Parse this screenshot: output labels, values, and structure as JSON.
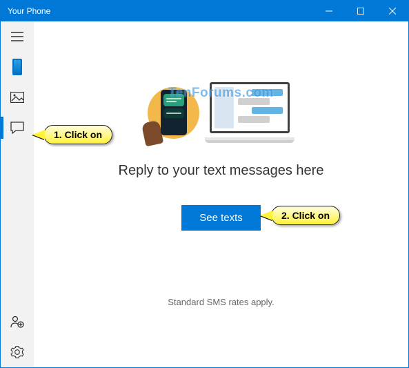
{
  "titlebar": {
    "title": "Your Phone"
  },
  "sidebar": {
    "menu_icon": "menu",
    "phone_icon": "phone-device",
    "photos_icon": "image",
    "messages_icon": "chat",
    "link_icon": "person-link",
    "settings_icon": "gear"
  },
  "content": {
    "watermark": "TenForums.com",
    "heading": "Reply to your text messages here",
    "button_label": "See texts",
    "footnote": "Standard SMS rates apply."
  },
  "callouts": {
    "step1": "1. Click on",
    "step2": "2. Click on"
  },
  "colors": {
    "accent": "#0078d7"
  }
}
